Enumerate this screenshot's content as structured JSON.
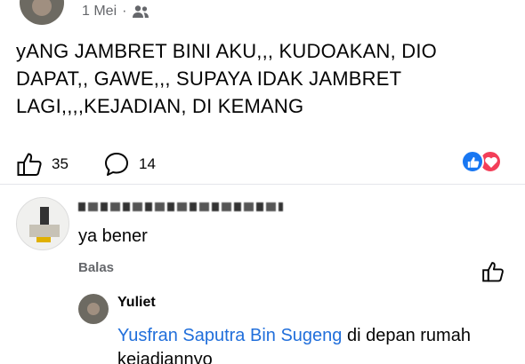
{
  "post": {
    "date": "1 Mei",
    "separator": "·",
    "audience_icon": "friends-icon",
    "text": "yANG JAMBRET BINI AKU,,, KUDOAKAN, DIO DAPAT,, GAWE,,, SUPAYA IDAK JAMBRET LAGI,,,,KEJADIAN, DI KEMANG"
  },
  "actions": {
    "like_count": "35",
    "comment_count": "14"
  },
  "reactions": [
    "like",
    "love"
  ],
  "comment": {
    "author": "Yusfran Saputra Bin Sugeng",
    "text": "ya bener",
    "reply_label": "Balas"
  },
  "reply": {
    "author": "Yuliet",
    "mention": "Yusfran Saputra Bin Sugeng",
    "text": " di depan rumah kejadiannyo"
  },
  "colors": {
    "link": "#216fdb",
    "like_reaction": "#1877f2",
    "love_reaction": "#f33e58",
    "meta": "#65676b"
  }
}
